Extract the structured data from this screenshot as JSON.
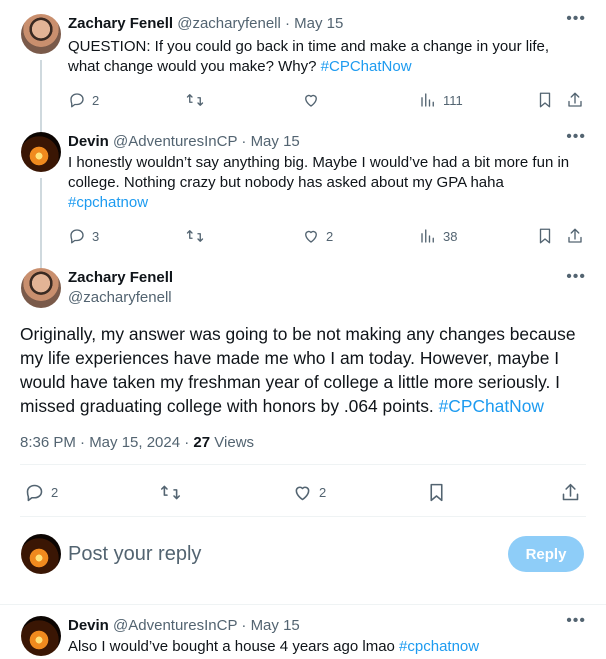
{
  "tweet1": {
    "name": "Zachary Fenell",
    "handle": "@zacharyfenell",
    "sep": "·",
    "date": "May 15",
    "text_line1": "QUESTION: If you could go back in time and make a change in your life,",
    "text_line2": "what change would you make? Why?",
    "hashtag": "#CPChatNow",
    "replies": "2",
    "views": "111"
  },
  "tweet2": {
    "name": "Devin",
    "handle": "@AdventuresInCP",
    "sep": "·",
    "date": "May 15",
    "text_line1": "I honestly wouldn’t say anything big. Maybe I would’ve had a bit more fun in",
    "text_line2": "college. Nothing crazy but nobody has asked about my GPA haha",
    "hashtag": "#cpchatnow",
    "replies": "3",
    "likes": "2",
    "views": "38"
  },
  "main": {
    "name": "Zachary Fenell",
    "handle": "@zacharyfenell",
    "line1": "Originally, my answer was going to be not making any changes because",
    "line2": "my life experiences have made me who I am today. However, maybe I",
    "line3": "would have taken my freshman year of college a little more seriously. I",
    "line4": "missed graduating college with honors by .064 points.",
    "hashtag": "#CPChatNow",
    "time": "8:36 PM · May 15, 2024 ·",
    "views_count": "27",
    "views_label": "Views",
    "replies": "2",
    "likes": "2"
  },
  "composer": {
    "placeholder": "Post your reply",
    "button": "Reply"
  },
  "tweet3": {
    "name": "Devin",
    "handle": "@AdventuresInCP",
    "sep": "·",
    "date": "May 15",
    "text": "Also I would’ve bought a house 4 years ago lmao",
    "hashtag": "#cpchatnow"
  },
  "icons": {
    "more": "more-horizontal-icon",
    "reply": "reply-icon",
    "retweet": "retweet-icon",
    "like": "heart-icon",
    "views": "views-chart-icon",
    "bookmark": "bookmark-icon",
    "share": "share-icon"
  },
  "colors": {
    "link": "#1d9bf0",
    "reply_button": "#8ecdf8",
    "muted": "#536471"
  }
}
